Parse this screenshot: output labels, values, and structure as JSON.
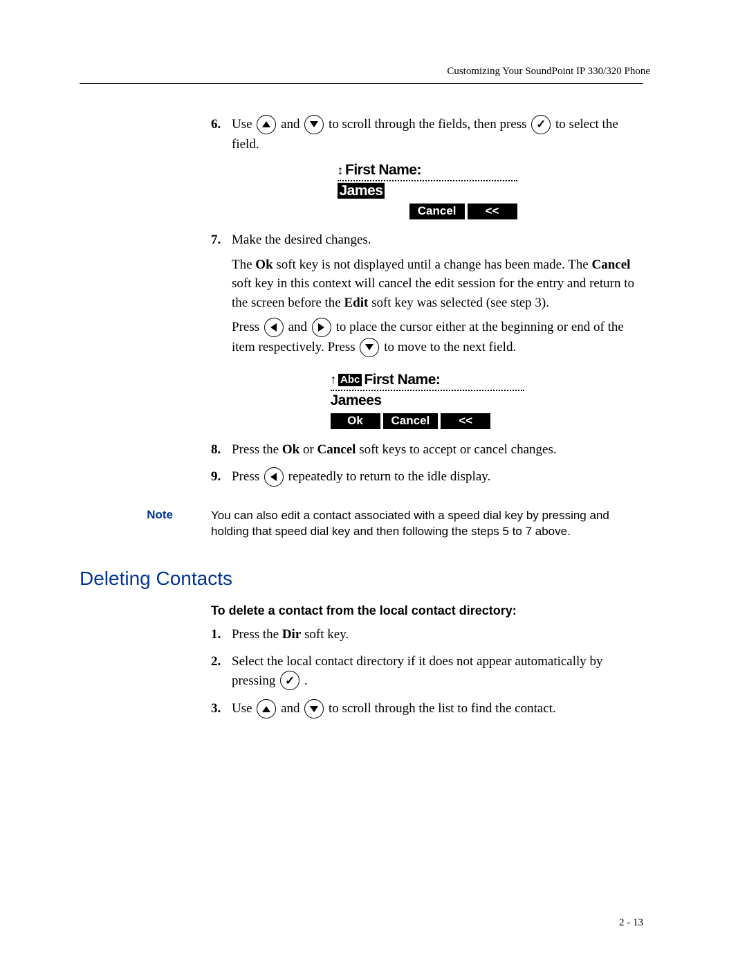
{
  "page": {
    "header": "Customizing Your SoundPoint IP 330/320 Phone",
    "page_number": "2 - 13"
  },
  "icons": {
    "up": "up-arrow-icon",
    "down": "down-arrow-icon",
    "left": "left-arrow-icon",
    "right": "right-arrow-icon",
    "check": "check-icon"
  },
  "step6": {
    "num": "6.",
    "t1": "Use ",
    "t2": " and ",
    "t3": " to scroll through the fields, then press ",
    "t4": " to select the field."
  },
  "screen1": {
    "title_prefix": "↕",
    "title": "First Name:",
    "entry": "James",
    "softkeys": [
      "Cancel",
      "<<"
    ]
  },
  "step7": {
    "num": "7.",
    "line1": "Make the desired changes.",
    "para1a": "The ",
    "ok": "Ok",
    "para1b": " soft key is not displayed until a change has been made. The ",
    "cancel": "Cancel",
    "para1c": " soft key in this context will cancel the edit session for the entry and return to the screen before the ",
    "edit": "Edit",
    "para1d": " soft key was selected (see step 3).",
    "para2a": "Press ",
    "para2b": " and ",
    "para2c": " to place the cursor either at the beginning or end of the item respectively. Press ",
    "para2d": " to move to the next field."
  },
  "screen2": {
    "title_prefix_arrow": "↑",
    "title_badge": "Abc",
    "title": "First Name:",
    "entry": "Jamees",
    "softkeys": [
      "Ok",
      "Cancel",
      "<<"
    ]
  },
  "step8": {
    "num": "8.",
    "t1": "Press the ",
    "ok": "Ok",
    "t2": " or ",
    "cancel": "Cancel",
    "t3": " soft keys to accept or cancel changes."
  },
  "step9": {
    "num": "9.",
    "t1": "Press ",
    "t2": " repeatedly to return to the idle display."
  },
  "note": {
    "label": "Note",
    "text": "You can also edit a contact associated with a speed dial key by pressing and holding that speed dial key and then following the steps 5 to 7 above."
  },
  "section_heading": "Deleting Contacts",
  "sub_heading": "To delete a contact from the local contact directory:",
  "d1": {
    "num": "1.",
    "t1": "Press the ",
    "dir": "Dir",
    "t2": " soft key."
  },
  "d2": {
    "num": "2.",
    "t1": "Select the local contact directory if it does not appear automatically by pressing ",
    "t2": " ."
  },
  "d3": {
    "num": "3.",
    "t1": "Use ",
    "t2": " and ",
    "t3": " to scroll through the list to find the contact."
  }
}
